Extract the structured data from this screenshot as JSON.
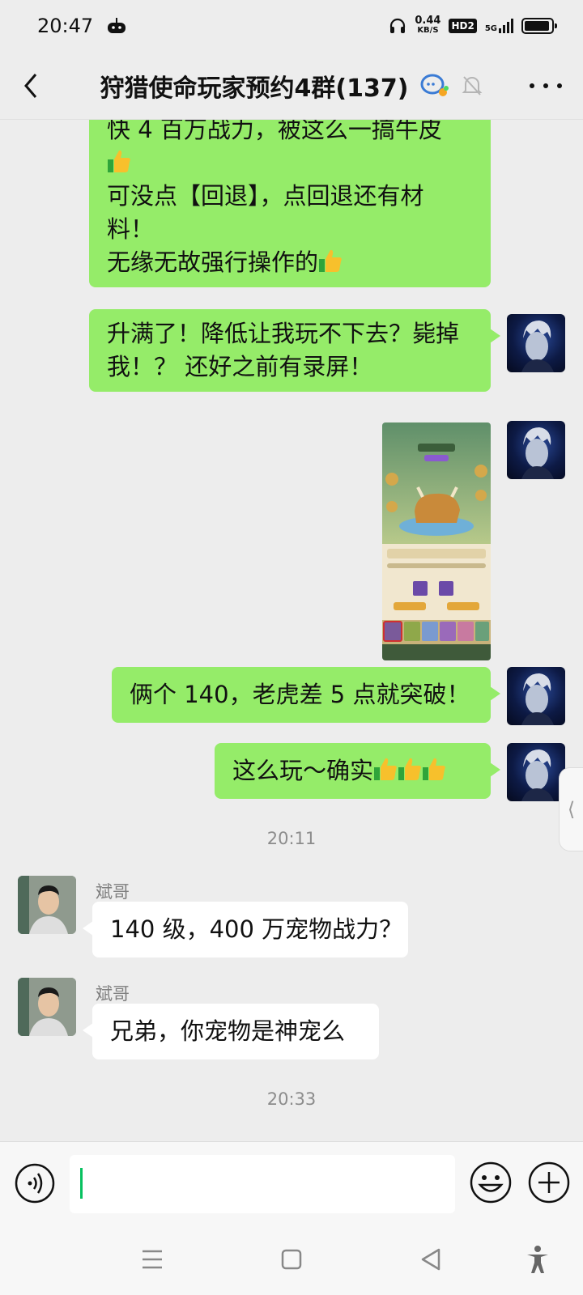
{
  "status_bar": {
    "time": "20:47",
    "net_speed": "0.44",
    "net_unit": "KB/S",
    "hd_label": "HD2",
    "network_label": "5G",
    "battery_level": 0.95
  },
  "nav": {
    "title": "狩猎使命玩家预约4群(137)",
    "icons": [
      "back-icon",
      "group-chat-icon",
      "mute-bell-icon",
      "more-icon"
    ]
  },
  "messages": [
    {
      "from": "self",
      "lines": [
        "快 4 百万战力，被这么一搞牛皮",
        "👍",
        "可没点【回退】，点回退还有材",
        "料！",
        "无缘无故强行操作的👍"
      ]
    },
    {
      "from": "self",
      "lines": [
        "升满了！降低让我玩不下去？毙掉",
        "我！？ 还好之前有录屏！"
      ]
    },
    {
      "from": "self",
      "type": "image"
    },
    {
      "from": "self",
      "lines": [
        "俩个 140，老虎差 5 点就突破！"
      ]
    },
    {
      "from": "self",
      "lines": [
        "这么玩～确实👍👍👍"
      ]
    },
    {
      "type": "timestamp",
      "text": "20:11"
    },
    {
      "from": "other",
      "sender": "斌哥",
      "lines": [
        "140 级，400 万宠物战力？"
      ]
    },
    {
      "from": "other",
      "sender": "斌哥",
      "lines": [
        "兄弟，你宠物是神宠么"
      ]
    },
    {
      "type": "timestamp",
      "text": "20:33"
    }
  ],
  "side_handle": {
    "glyph": "⟨"
  },
  "input_bar": {
    "value": "",
    "icons": [
      "voice-icon",
      "emoji-icon",
      "plus-icon"
    ]
  },
  "system_nav": {
    "icons": [
      "menu-icon",
      "home-icon",
      "back-triangle-icon",
      "accessibility-icon"
    ]
  },
  "colors": {
    "background": "#ededed",
    "self_bubble": "#95ec69",
    "other_bubble": "#ffffff",
    "caret": "#07c160"
  }
}
